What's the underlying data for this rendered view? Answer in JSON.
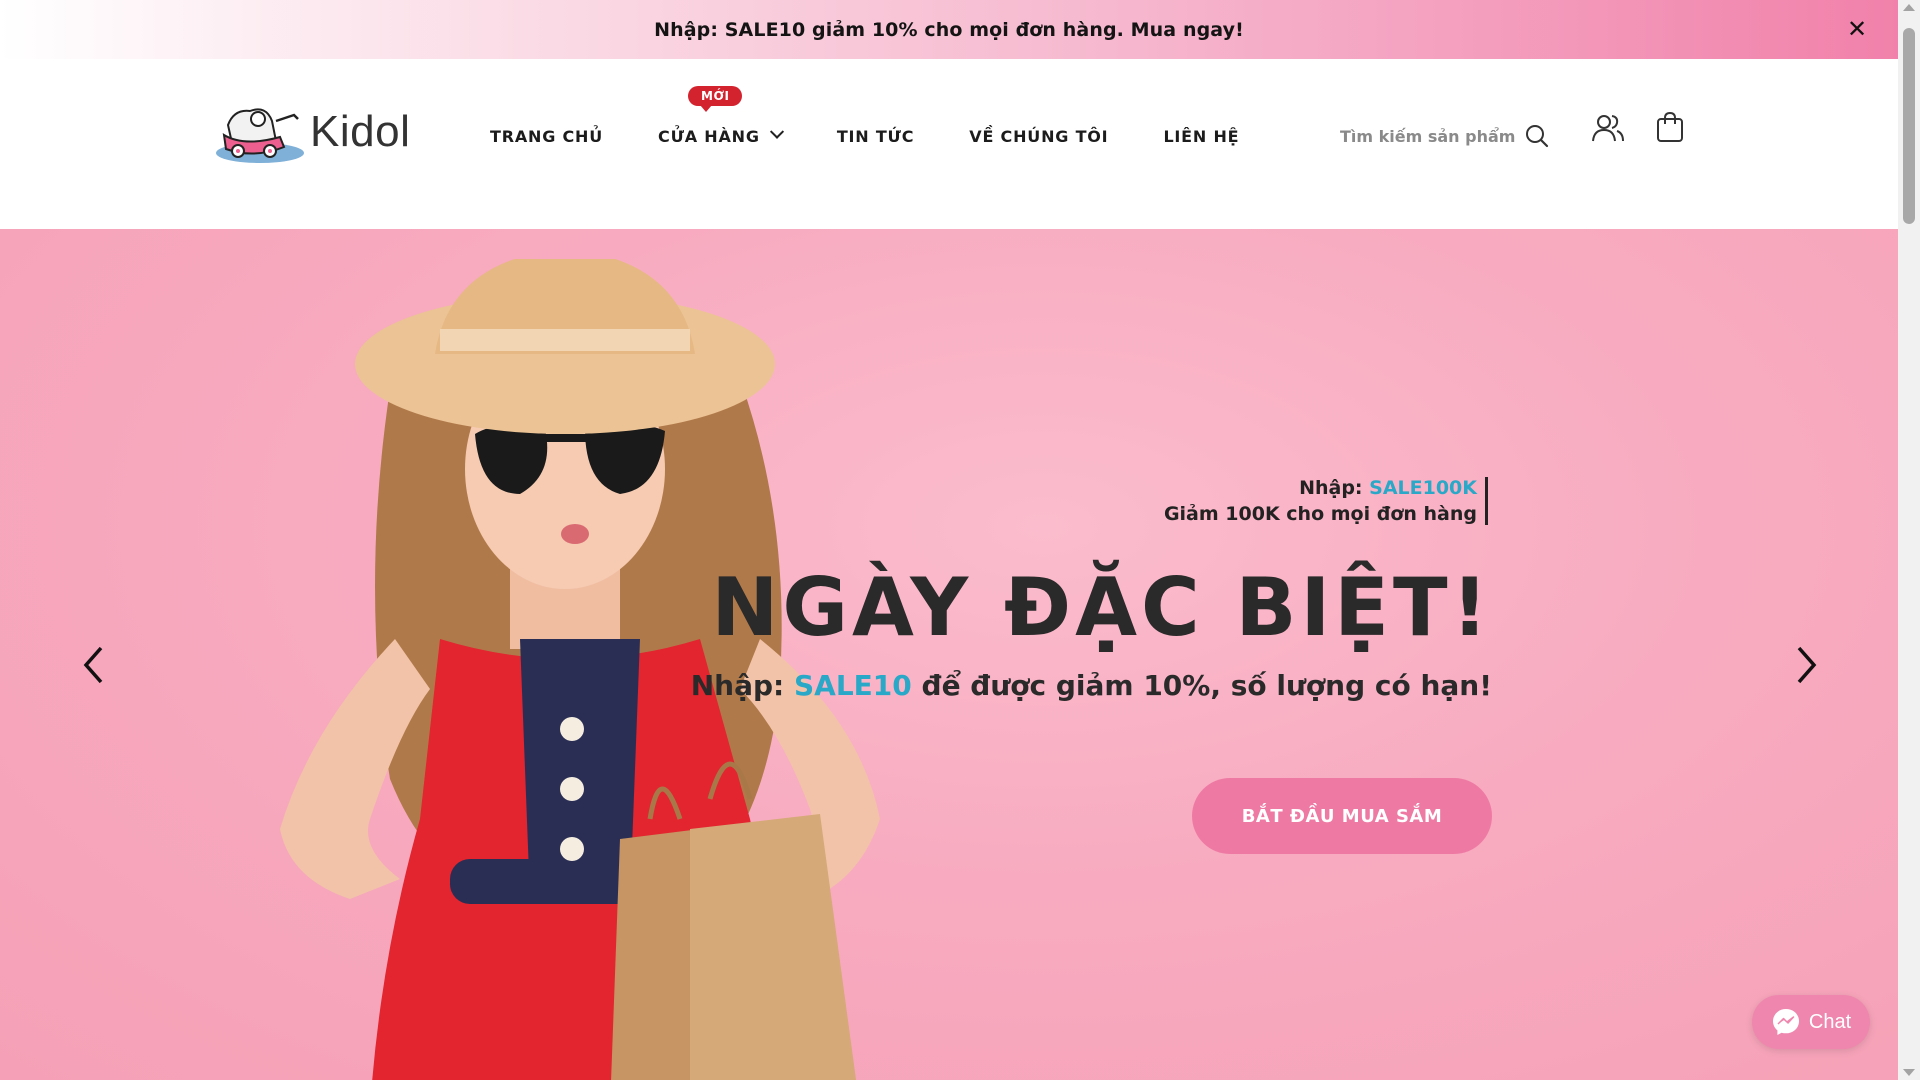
{
  "announcement": {
    "text": "Nhập: SALE10 giảm 10% cho mọi đơn hàng. Mua ngay!",
    "close_symbol": "✕"
  },
  "header": {
    "logo_text": "Kidol",
    "logo_icon": "baby-stroller-logo",
    "nav": [
      {
        "label": "TRANG CHỦ"
      },
      {
        "label": "CỬA HÀNG",
        "badge": "MỚI",
        "has_dropdown": true
      },
      {
        "label": "TIN TỨC"
      },
      {
        "label": "VỀ CHÚNG TÔI"
      },
      {
        "label": "LIÊN HỆ"
      }
    ],
    "search": {
      "placeholder": "Tìm kiếm sản phẩm",
      "icon": "search-icon"
    },
    "user_icon": "user-icon",
    "cart_icon": "shopping-bag-icon"
  },
  "hero": {
    "promo_prefix": "Nhập: ",
    "promo_code": "SALE100K",
    "promo_desc": "Giảm 100K cho mọi đơn hàng",
    "title": "NGÀY ĐẶC BIỆT!",
    "sub_prefix": "Nhập: ",
    "sub_code": "SALE10",
    "sub_suffix": " để được giảm 10%, số lượng có hạn!",
    "cta_label": "BẮT ĐẦU MUA SẮM",
    "prev_icon": "chevron-left-icon",
    "next_icon": "chevron-right-icon"
  },
  "chat": {
    "label": "Chat",
    "icon": "messenger-icon"
  },
  "colors": {
    "accent_pink": "#ee7aa4",
    "hero_bg": "#f8abc0",
    "code_blue": "#29a8c7",
    "badge_red": "#d3232f"
  }
}
